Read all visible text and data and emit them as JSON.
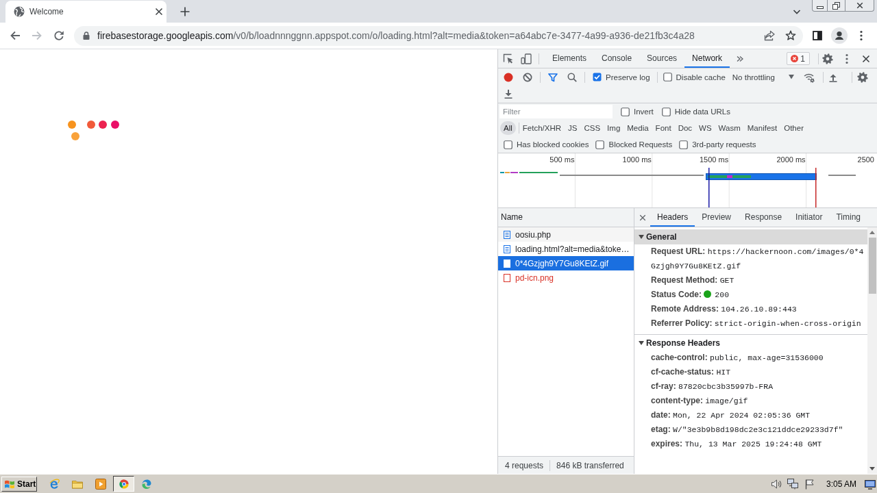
{
  "browser": {
    "tabs": [
      {
        "title": "Welcome",
        "selected": true
      }
    ],
    "address": {
      "host": "firebasestorage.googleapis.com",
      "path": "/v0/b/loadnnnggnn.appspot.com/o/loading.html?alt=media&token=a64abc7e-3477-4a99-a936-de21fb3c4a28"
    }
  },
  "page": {
    "loader_dots": [
      {
        "color": "#f7931e"
      },
      {
        "color": "#f9a23a"
      },
      {
        "color": "#f15a3a"
      },
      {
        "color": "#ec2350"
      },
      {
        "color": "#ea1068"
      }
    ]
  },
  "devtools": {
    "panel_tabs": [
      {
        "label": "Elements",
        "selected": false
      },
      {
        "label": "Console",
        "selected": false
      },
      {
        "label": "Sources",
        "selected": false
      },
      {
        "label": "Network",
        "selected": true
      }
    ],
    "error_count": "1",
    "recording": true,
    "preserve_log": {
      "label": "Preserve log",
      "checked": true
    },
    "disable_cache": {
      "label": "Disable cache",
      "checked": false
    },
    "throttling": "No throttling",
    "filter": {
      "placeholder": "Filter",
      "options": [
        {
          "label": "Invert",
          "checked": false
        },
        {
          "label": "Hide data URLs",
          "checked": false
        }
      ]
    },
    "type_filters": [
      {
        "label": "All",
        "selected": true
      },
      {
        "label": "Fetch/XHR",
        "selected": false
      },
      {
        "label": "JS",
        "selected": false
      },
      {
        "label": "CSS",
        "selected": false
      },
      {
        "label": "Img",
        "selected": false
      },
      {
        "label": "Media",
        "selected": false
      },
      {
        "label": "Font",
        "selected": false
      },
      {
        "label": "Doc",
        "selected": false
      },
      {
        "label": "WS",
        "selected": false
      },
      {
        "label": "Wasm",
        "selected": false
      },
      {
        "label": "Manifest",
        "selected": false
      },
      {
        "label": "Other",
        "selected": false
      }
    ],
    "request_filters": [
      {
        "label": "Has blocked cookies",
        "checked": false
      },
      {
        "label": "Blocked Requests",
        "checked": false
      },
      {
        "label": "3rd-party requests",
        "checked": false
      }
    ],
    "overview": {
      "ticks": [
        "500 ms",
        "1000 ms",
        "1500 ms",
        "2000 ms",
        "2500"
      ]
    },
    "requests": {
      "column": "Name",
      "rows": [
        {
          "name": "oosiu.php",
          "kind": "document",
          "failed": false,
          "selected": false
        },
        {
          "name": "loading.html?alt=media&toke…",
          "kind": "document",
          "failed": false,
          "selected": false
        },
        {
          "name": "0*4Gzjgh9Y7Gu8KEtZ.gif",
          "kind": "image",
          "failed": false,
          "selected": true
        },
        {
          "name": "pd-icn.png",
          "kind": "image",
          "failed": true,
          "selected": false
        }
      ]
    },
    "status": [
      "4 requests",
      "846 kB transferred"
    ],
    "details": {
      "tabs": [
        {
          "label": "Headers",
          "selected": true
        },
        {
          "label": "Preview",
          "selected": false
        },
        {
          "label": "Response",
          "selected": false
        },
        {
          "label": "Initiator",
          "selected": false
        },
        {
          "label": "Timing",
          "selected": false
        }
      ],
      "sections": [
        {
          "title": "General",
          "expanded": true,
          "selected": true,
          "rows": [
            {
              "name": "Request URL:",
              "value": "https://hackernoon.com/images/0*4Gzjgh9Y7Gu8KEtZ.gif",
              "kind": "text"
            },
            {
              "name": "Request Method:",
              "value": "GET",
              "kind": "text"
            },
            {
              "name": "Status Code:",
              "value": "200",
              "kind": "status"
            },
            {
              "name": "Remote Address:",
              "value": "104.26.10.89:443",
              "kind": "text"
            },
            {
              "name": "Referrer Policy:",
              "value": "strict-origin-when-cross-origin",
              "kind": "text"
            }
          ]
        },
        {
          "title": "Response Headers",
          "expanded": true,
          "selected": false,
          "rows": [
            {
              "name": "cache-control:",
              "value": "public, max-age=31536000",
              "kind": "text"
            },
            {
              "name": "cf-cache-status:",
              "value": "HIT",
              "kind": "text"
            },
            {
              "name": "cf-ray:",
              "value": "87820cbc3b35997b-FRA",
              "kind": "text"
            },
            {
              "name": "content-type:",
              "value": "image/gif",
              "kind": "text"
            },
            {
              "name": "date:",
              "value": "Mon, 22 Apr 2024 02:05:36 GMT",
              "kind": "text"
            },
            {
              "name": "etag:",
              "value": "W/\"3e3b9b8d198dc2e3c121ddce29233d7f\"",
              "kind": "text"
            },
            {
              "name": "expires:",
              "value": "Thu, 13 Mar 2025 19:24:48 GMT",
              "kind": "text"
            }
          ]
        }
      ]
    }
  },
  "taskbar": {
    "start": "Start",
    "clock": "3:05 AM"
  }
}
